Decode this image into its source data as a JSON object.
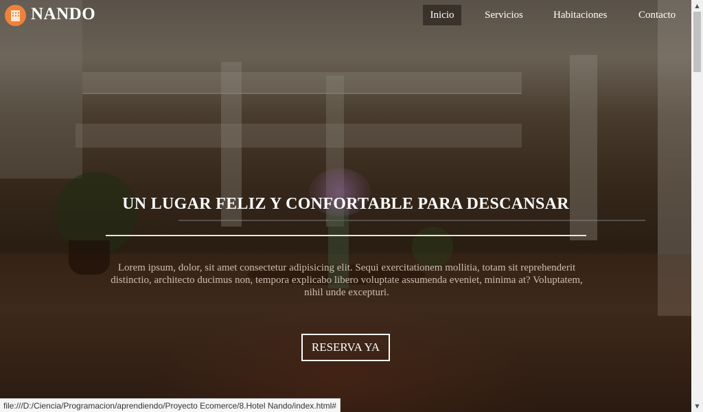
{
  "brand": {
    "name": "NANDO",
    "logo_icon": "hotel-building-icon",
    "logo_color": "#f0813a"
  },
  "nav": {
    "items": [
      {
        "label": "Inicio",
        "active": true
      },
      {
        "label": "Servicios"
      },
      {
        "label": "Habitaciones"
      },
      {
        "label": "Contacto"
      }
    ]
  },
  "hero": {
    "headline": "UN LUGAR FELIZ Y CONFORTABLE PARA DESCANSAR",
    "description": "Lorem ipsum, dolor, sit amet consectetur adipisicing elit. Sequi exercitationem mollitia, totam sit reprehenderit distinctio, architecto ducimus non, tempora explicabo libero voluptate assumenda eveniet, minima at? Voluptatem, nihil unde excepturi.",
    "cta_label": "RESERVA YA"
  },
  "statusbar": {
    "url": "file:///D:/Ciencia/Programacion/aprendiendo/Proyecto Ecomerce/8.Hotel Nando/index.html#"
  },
  "colors": {
    "text": "#ffffff",
    "description": "#cdbfae"
  }
}
